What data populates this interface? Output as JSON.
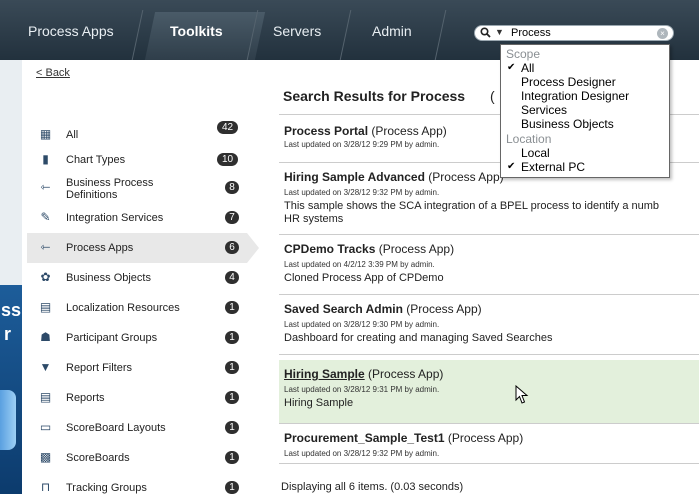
{
  "nav": {
    "tabs": [
      {
        "label": "Process Apps"
      },
      {
        "label": "Toolkits"
      },
      {
        "label": "Servers"
      },
      {
        "label": "Admin"
      }
    ],
    "search_value": "Process"
  },
  "dropdown": {
    "scope_heading": "Scope",
    "scope_items": [
      "All",
      "Process Designer",
      "Integration Designer",
      "Services",
      "Business Objects"
    ],
    "location_heading": "Location",
    "location_items": [
      "Local",
      "External PC"
    ]
  },
  "left": {
    "back_label": "< Back",
    "items": [
      {
        "label": "All",
        "count": "42",
        "icon": "grid-icon"
      },
      {
        "label": "Chart Types",
        "count": "10",
        "icon": "bar-chart-icon"
      },
      {
        "label": "Business Process Definitions",
        "count": "8",
        "icon": "process-definition-icon"
      },
      {
        "label": "Integration Services",
        "count": "7",
        "icon": "integration-service-icon"
      },
      {
        "label": "Process Apps",
        "count": "6",
        "icon": "process-app-icon"
      },
      {
        "label": "Business Objects",
        "count": "4",
        "icon": "business-object-icon"
      },
      {
        "label": "Localization Resources",
        "count": "1",
        "icon": "localization-icon"
      },
      {
        "label": "Participant Groups",
        "count": "1",
        "icon": "participant-group-icon"
      },
      {
        "label": "Report Filters",
        "count": "1",
        "icon": "filter-icon"
      },
      {
        "label": "Reports",
        "count": "1",
        "icon": "report-icon"
      },
      {
        "label": "ScoreBoard Layouts",
        "count": "1",
        "icon": "scoreboard-layout-icon"
      },
      {
        "label": "ScoreBoards",
        "count": "1",
        "icon": "scoreboard-icon"
      },
      {
        "label": "Tracking Groups",
        "count": "1",
        "icon": "tracking-group-icon"
      }
    ]
  },
  "results": {
    "title": "Search Results for Process",
    "title_paren": "(",
    "items": [
      {
        "name": "Process Portal",
        "type": "(Process App)",
        "meta": "Last updated on 3/28/12 9:29 PM by admin.",
        "desc": ""
      },
      {
        "name": "Hiring Sample Advanced",
        "type": "(Process App)",
        "meta": "Last updated on 3/28/12 9:32 PM by admin.",
        "desc": "This sample shows the SCA integration of a BPEL process to identify a numb",
        "desc2": "HR systems"
      },
      {
        "name": "CPDemo Tracks",
        "type": "(Process App)",
        "meta": "Last updated on 4/2/12 3:39 PM by admin.",
        "desc": "Cloned Process App of CPDemo"
      },
      {
        "name": "Saved Search Admin",
        "type": "(Process App)",
        "meta": "Last updated on 3/28/12 9:30 PM by admin.",
        "desc": "Dashboard for creating and managing Saved Searches"
      },
      {
        "name": "Hiring Sample",
        "type": "(Process App)",
        "meta": "Last updated on 3/28/12 9:31 PM by admin.",
        "desc": "Hiring Sample"
      },
      {
        "name": "Procurement_Sample_Test1",
        "type": "(Process App)",
        "meta": "Last updated on 3/28/12 9:32 PM by admin.",
        "desc": ""
      }
    ],
    "footer": "Displaying all 6 items.  (0.03 seconds)"
  },
  "background": {
    "fragments": [
      "ss",
      "r"
    ]
  },
  "colors": {
    "nav_bg": "#2b3a46",
    "highlight_row": "#e3f0dc",
    "badge": "#2f2f2f"
  }
}
